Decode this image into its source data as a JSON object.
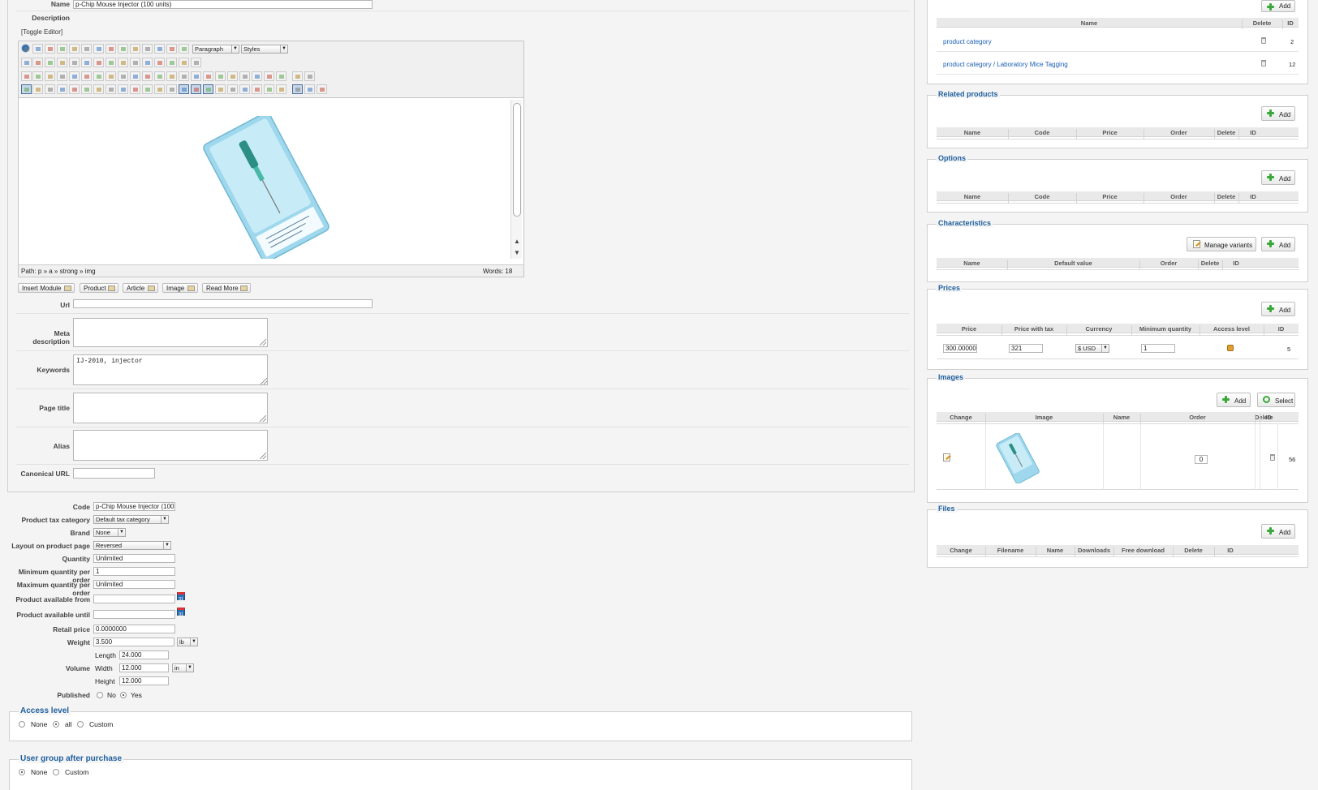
{
  "form": {
    "name_label": "Name",
    "name_value": "p-Chip Mouse Injector (100 units)",
    "description_label": "Description",
    "toggle_editor": "[Toggle Editor]",
    "editor": {
      "format_select": "Paragraph",
      "styles_select": "Styles",
      "path_text": "Path:  p » a » strong » img",
      "words_text": "Words: 18"
    },
    "insert_buttons": [
      "Insert Module",
      "Product",
      "Article",
      "Image",
      "Read More"
    ],
    "url_label": "Url",
    "meta_description_label": "Meta description",
    "keywords_label": "Keywords",
    "keywords_value": "IJ-2010, injector",
    "page_title_label": "Page title",
    "alias_label": "Alias",
    "canonical_url_label": "Canonical URL"
  },
  "details": {
    "code_label": "Code",
    "code_value": "p-Chip Mouse Injector (100",
    "tax_label": "Product tax category",
    "tax_value": "Default tax category",
    "brand_label": "Brand",
    "brand_value": "None",
    "layout_label": "Layout on product page",
    "layout_value": "Reversed",
    "quantity_label": "Quantity",
    "quantity_value": "Unlimited",
    "min_qty_label": "Minimum quantity per order",
    "min_qty_value": "1",
    "max_qty_label": "Maximum quantity per order",
    "max_qty_value": "Unlimited",
    "avail_from_label": "Product available from",
    "avail_until_label": "Product available until",
    "calendar_text": "31",
    "retail_label": "Retail price",
    "retail_value": "0.0000000",
    "weight_label": "Weight",
    "weight_value": "3.500",
    "weight_unit": "lb",
    "volume_label": "Volume",
    "length_label": "Length",
    "length_value": "24.000",
    "width_label": "Width",
    "width_value": "12.000",
    "width_unit": "in",
    "height_label": "Height",
    "height_value": "12.000",
    "published_label": "Published",
    "published_no": "No",
    "published_yes": "Yes"
  },
  "access_level": {
    "legend": "Access level",
    "options": [
      "None",
      "all",
      "Custom"
    ]
  },
  "user_group": {
    "legend": "User group after purchase",
    "options": [
      "None",
      "Custom"
    ]
  },
  "right": {
    "add_label": "Add",
    "select_label": "Select",
    "manage_variants_label": "Manage variants",
    "categories": {
      "columns": [
        "Name",
        "Delete",
        "ID"
      ],
      "rows": [
        {
          "name": "product category",
          "id": "2"
        },
        {
          "name": "product category / Laboratory Mice Tagging",
          "id": "12"
        }
      ]
    },
    "related_products": {
      "legend": "Related products",
      "columns": [
        "Name",
        "Code",
        "Price",
        "Order",
        "Delete",
        "ID"
      ]
    },
    "options": {
      "legend": "Options",
      "columns": [
        "Name",
        "Code",
        "Price",
        "Order",
        "Delete",
        "ID"
      ]
    },
    "characteristics": {
      "legend": "Characteristics",
      "columns": [
        "Name",
        "Default value",
        "Order",
        "Delete",
        "ID"
      ]
    },
    "prices": {
      "legend": "Prices",
      "columns": [
        "Price",
        "Price with tax",
        "Currency",
        "Minimum quantity",
        "Access level",
        "ID"
      ],
      "row": {
        "price": "300.00000",
        "price_tax": "321",
        "currency": "$ USD",
        "min_qty": "1",
        "id": "5"
      }
    },
    "images": {
      "legend": "Images",
      "columns": [
        "Change",
        "Image",
        "Name",
        "Order",
        "Delete",
        "ID"
      ],
      "row": {
        "order": "0",
        "id": "56"
      }
    },
    "files": {
      "legend": "Files",
      "columns": [
        "Change",
        "Filename",
        "Name",
        "Downloads",
        "Free download",
        "Delete",
        "ID"
      ]
    }
  }
}
